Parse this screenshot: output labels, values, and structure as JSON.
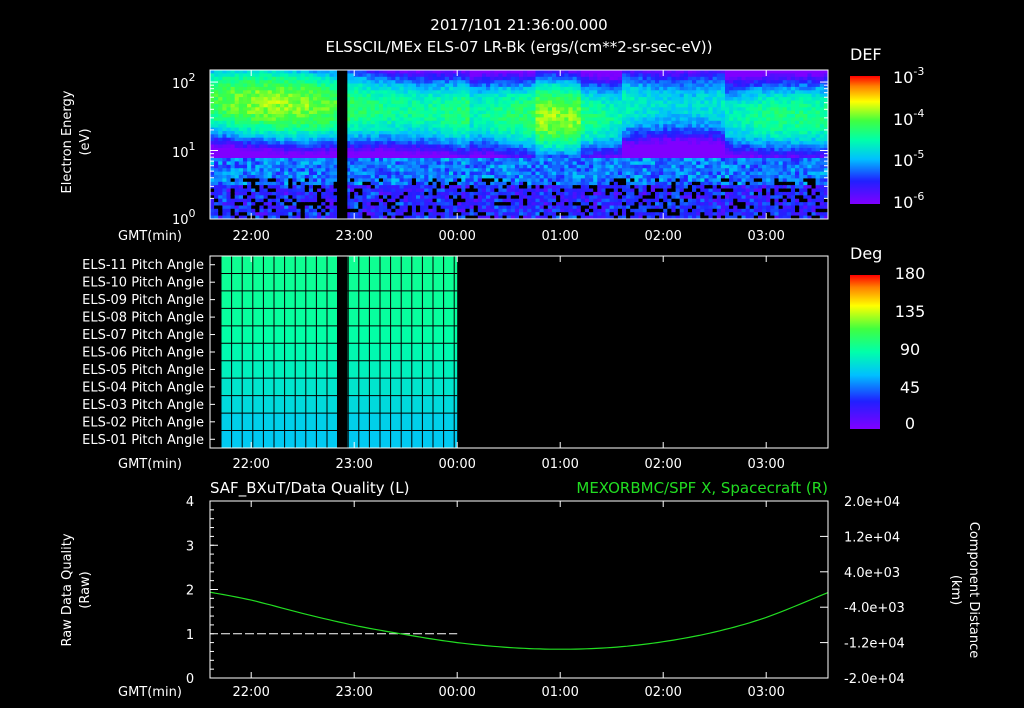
{
  "header": {
    "timestamp": "2017/101 21:36:00.000",
    "title": "ELSSCIL/MEx ELS-07 LR-Bk  (ergs/(cm**2-sr-sec-eV))"
  },
  "time_axis": {
    "label": "GMT(min)",
    "ticks": [
      "22:00",
      "23:00",
      "00:00",
      "01:00",
      "02:00",
      "03:00"
    ]
  },
  "panel1": {
    "ylabel_line1": "Electron Energy",
    "ylabel_line2": "(eV)",
    "yticks": [
      "10",
      "10",
      "10"
    ],
    "ytick_exps": [
      "2",
      "1",
      "0"
    ],
    "colorbar_label": "DEF",
    "colorbar_ticks": [
      "10",
      "10",
      "10",
      "10"
    ],
    "colorbar_exps": [
      "-3",
      "-4",
      "-5",
      "-6"
    ]
  },
  "panel2": {
    "rows": [
      "ELS-11 Pitch Angle",
      "ELS-10 Pitch Angle",
      "ELS-09 Pitch Angle",
      "ELS-08 Pitch Angle",
      "ELS-07 Pitch Angle",
      "ELS-06 Pitch Angle",
      "ELS-05 Pitch Angle",
      "ELS-04 Pitch Angle",
      "ELS-03 Pitch Angle",
      "ELS-02 Pitch Angle",
      "ELS-01 Pitch Angle"
    ],
    "colorbar_label": "Deg",
    "colorbar_ticks": [
      "180",
      "135",
      "90",
      "45",
      "0"
    ]
  },
  "panel3": {
    "left_title": "SAF_BXuT/Data Quality (L)",
    "right_title": "MEXORBMC/SPF X, Spacecraft (R)",
    "ylabel_left_line1": "Raw Data Quality",
    "ylabel_left_line2": "(Raw)",
    "ylabel_right_line1": "Component Distance",
    "ylabel_right_line2": "(km)",
    "yticks_left": [
      "4",
      "3",
      "2",
      "1",
      "0"
    ],
    "yticks_right": [
      "2.0e+04",
      "1.2e+04",
      "4.0e+03",
      "-4.0e+03",
      "-1.2e+04",
      "-2.0e+04"
    ]
  },
  "colors": {
    "series_green": "#22dd22",
    "background": "#000000",
    "axis": "#ffffff"
  },
  "chart_data": [
    {
      "type": "heatmap",
      "title": "ELSSCIL/MEx ELS-07 LR-Bk  (ergs/(cm**2-sr-sec-eV))",
      "xlabel": "GMT(min)",
      "ylabel": "Electron Energy (eV)",
      "x_ticks": [
        "22:00",
        "23:00",
        "00:00",
        "01:00",
        "02:00",
        "03:00"
      ],
      "y_scale": "log",
      "ylim": [
        1,
        150
      ],
      "colorbar": {
        "label": "DEF",
        "scale": "log",
        "range": [
          1e-06,
          0.001
        ]
      },
      "data_gaps": [
        [
          "22:50",
          "22:56"
        ]
      ]
    },
    {
      "type": "heatmap",
      "xlabel": "GMT(min)",
      "categories": [
        "ELS-11 Pitch Angle",
        "ELS-10 Pitch Angle",
        "ELS-09 Pitch Angle",
        "ELS-08 Pitch Angle",
        "ELS-07 Pitch Angle",
        "ELS-06 Pitch Angle",
        "ELS-05 Pitch Angle",
        "ELS-04 Pitch Angle",
        "ELS-03 Pitch Angle",
        "ELS-02 Pitch Angle",
        "ELS-01 Pitch Angle"
      ],
      "values_deg": [
        96,
        95,
        94,
        93,
        91,
        88,
        84,
        79,
        74,
        70,
        67
      ],
      "data_span": [
        "21:36",
        "00:00"
      ],
      "data_gaps": [
        [
          "22:50",
          "22:56"
        ]
      ],
      "colorbar": {
        "label": "Deg",
        "range": [
          0,
          180
        ]
      }
    },
    {
      "type": "line",
      "xlabel": "GMT(min)",
      "series": [
        {
          "name": "SAF_BXuT/Data Quality",
          "axis": "left",
          "x": [
            "21:36",
            "22:00",
            "23:00",
            "00:00"
          ],
          "values": [
            1,
            1,
            1,
            1
          ]
        },
        {
          "name": "MEXORBMC/SPF X, Spacecraft",
          "axis": "right",
          "x": [
            "21:36",
            "22:00",
            "22:30",
            "23:00",
            "23:30",
            "00:00",
            "00:30",
            "01:00",
            "01:30",
            "02:00",
            "02:30",
            "03:00",
            "03:36"
          ],
          "values": [
            -600,
            -2400,
            -5400,
            -8100,
            -10200,
            -12000,
            -13100,
            -13500,
            -13100,
            -11800,
            -9600,
            -6300,
            -700
          ]
        }
      ],
      "ylim_left": [
        0,
        4
      ],
      "ylim_right": [
        -20000,
        20000
      ]
    }
  ]
}
